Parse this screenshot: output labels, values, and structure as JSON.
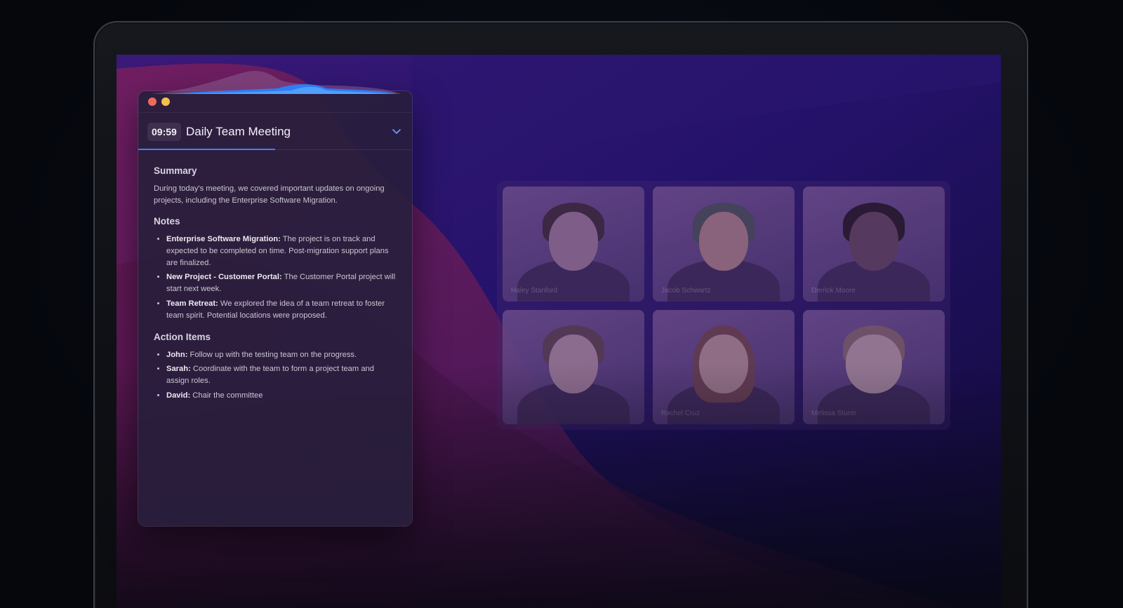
{
  "meeting": {
    "timer": "09:59",
    "title": "Daily Team Meeting",
    "progress_fraction": 0.5
  },
  "summary": {
    "heading": "Summary",
    "text": "During today's meeting, we covered important updates on ongoing projects, including the Enterprise Software Migration."
  },
  "notes": {
    "heading": "Notes",
    "items": [
      {
        "label": "Enterprise Software Migration:",
        "text": " The project is on track and expected to be completed on time. Post-migration support plans are finalized."
      },
      {
        "label": "New Project - Customer Portal:",
        "text": " The Customer Portal project will start next week."
      },
      {
        "label": "Team Retreat:",
        "text": " We explored the idea of a team retreat to foster team spirit. Potential locations were proposed."
      }
    ]
  },
  "action_items": {
    "heading": "Action Items",
    "items": [
      {
        "label": "John:",
        "text": " Follow up with the testing team on the progress."
      },
      {
        "label": "Sarah:",
        "text": " Coordinate with the team to form a project team and assign roles."
      },
      {
        "label": "David:",
        "text": " Chair the committee"
      }
    ]
  },
  "video_call": {
    "participants": [
      {
        "name": "Haley Stanford"
      },
      {
        "name": "Jacob Schwartz"
      },
      {
        "name": "Derrick Moore"
      },
      {
        "name": ""
      },
      {
        "name": "Rachel Cruz"
      },
      {
        "name": "Melissa Sturm"
      }
    ]
  },
  "colors": {
    "accent": "#3b82f6",
    "close_dot": "#ec6a5e",
    "minimize_dot": "#f4bf4f"
  },
  "icons": {
    "collapse": "chevron-down-icon"
  }
}
